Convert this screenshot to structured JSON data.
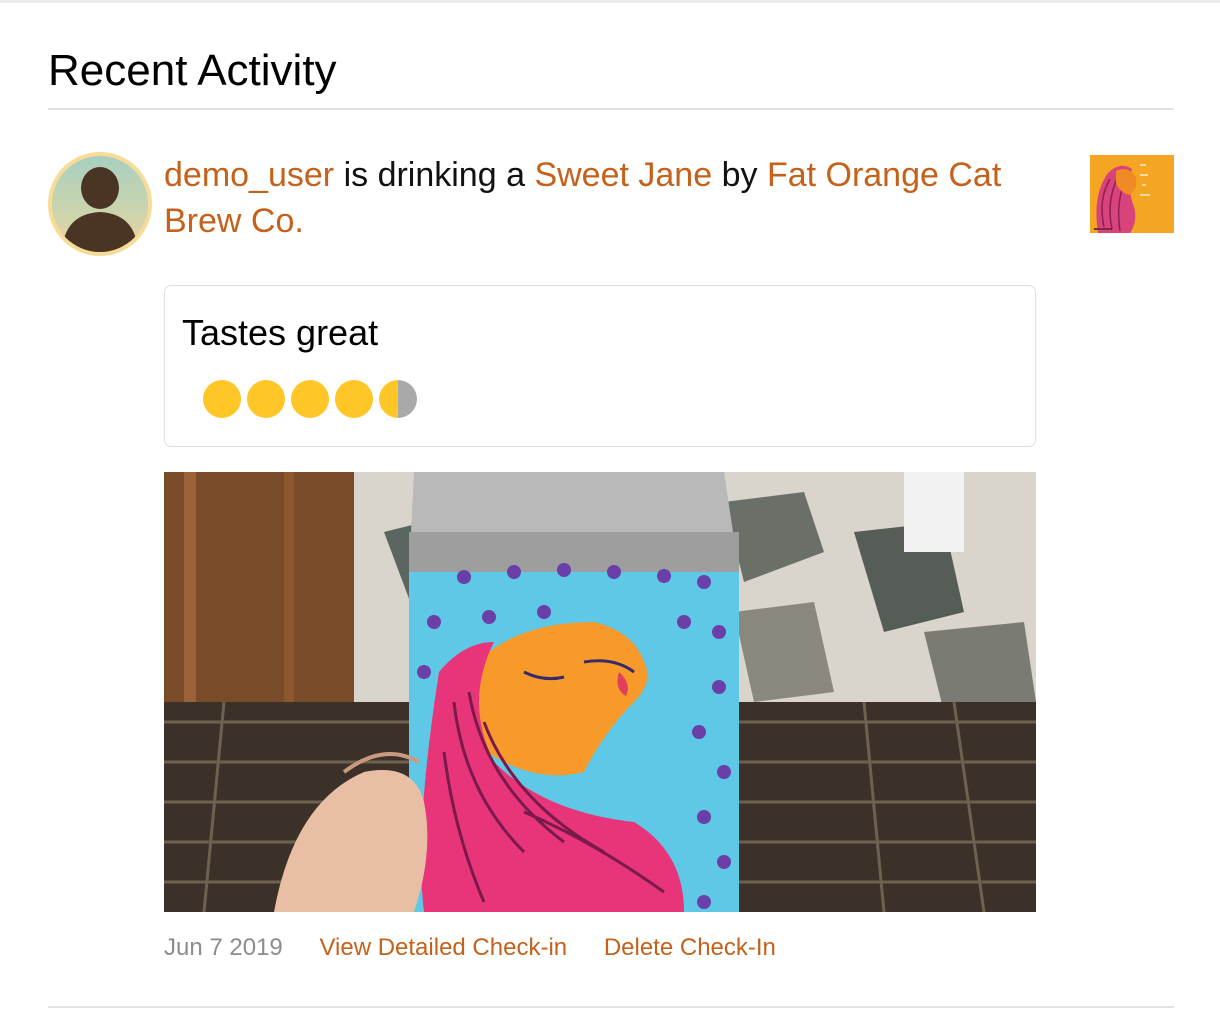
{
  "section": {
    "title": "Recent Activity"
  },
  "checkin": {
    "user": "demo_user",
    "phrase_drinking": "is drinking a",
    "beer_name": "Sweet Jane",
    "phrase_by": "by",
    "brewery": "Fat Orange Cat Brew Co.",
    "comment": "Tastes great",
    "rating": 4.5,
    "rating_max": 5,
    "date": "Jun 7 2019",
    "actions": {
      "view_detail": "View Detailed Check-in",
      "delete": "Delete Check-In"
    }
  },
  "colors": {
    "link": "#c4611a",
    "rating_cap": "#ffc628",
    "rating_empty": "#a9a9a9",
    "date": "#8c8c8c"
  },
  "icons": {
    "avatar": "default-user-silhouette-icon",
    "rating": "bottle-cap-icon"
  }
}
